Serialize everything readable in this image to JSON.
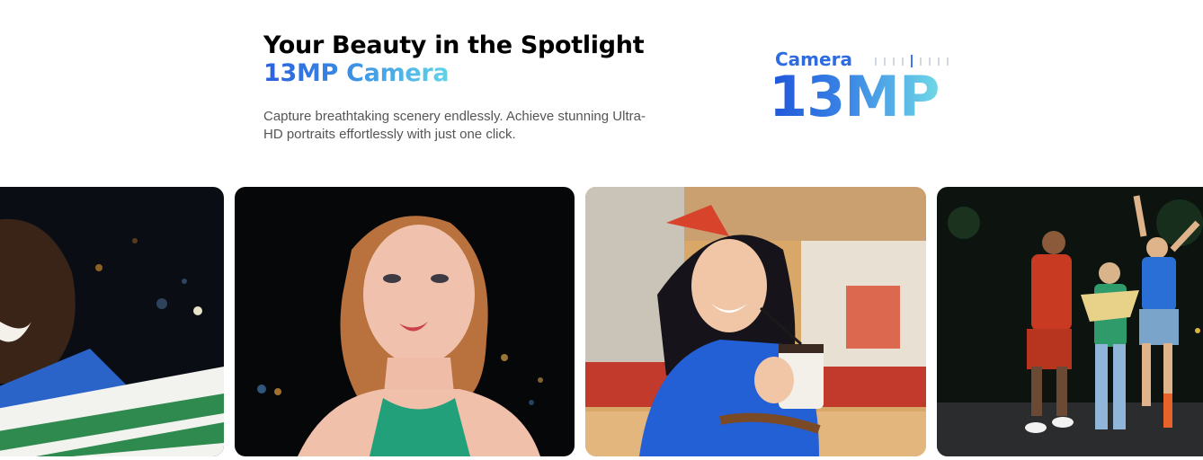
{
  "hero": {
    "title": "Your Beauty in the Spotlight",
    "subtitle": "13MP Camera",
    "description": "Capture breathtaking scenery endlessly. Achieve stunning Ultra-HD portraits effortlessly with just one click."
  },
  "badge": {
    "label": "Camera",
    "value": "13MP"
  },
  "photos": [
    {
      "id": "photo-man-night-portrait"
    },
    {
      "id": "photo-woman-night-portrait"
    },
    {
      "id": "photo-woman-cafe-drink"
    },
    {
      "id": "photo-group-night-dance"
    }
  ],
  "colors": {
    "gradient_start": "#2b5fe0",
    "gradient_end": "#63d3e8",
    "title": "#000000",
    "body_text": "#555555"
  }
}
